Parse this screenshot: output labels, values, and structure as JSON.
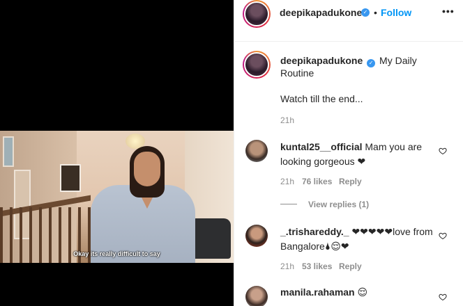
{
  "media": {
    "subtitle": "Okay its really difficult to say"
  },
  "header": {
    "username": "deepikapadukone",
    "verified_mark": "✓",
    "separator": "•",
    "follow_label": "Follow",
    "more_label": "•••"
  },
  "caption": {
    "username": "deepikapadukone",
    "text": "My Daily Routine",
    "text2": "Watch till the end...",
    "time": "21h"
  },
  "comments": [
    {
      "username": "kuntal25__official",
      "text": "Mam you are looking gorgeous ❤",
      "time": "21h",
      "likes": "76 likes",
      "reply": "Reply",
      "view_replies": "View replies (1)"
    },
    {
      "username": "_.trishareddy._",
      "text": "❤❤❤❤❤love from Bangalore🌢😌❤",
      "time": "21h",
      "likes": "53 likes",
      "reply": "Reply"
    },
    {
      "username": "manila.rahaman",
      "text": "😌"
    }
  ],
  "colors": {
    "follow": "#0095f6",
    "verified": "#3897f0",
    "muted": "#8e8e8e"
  }
}
